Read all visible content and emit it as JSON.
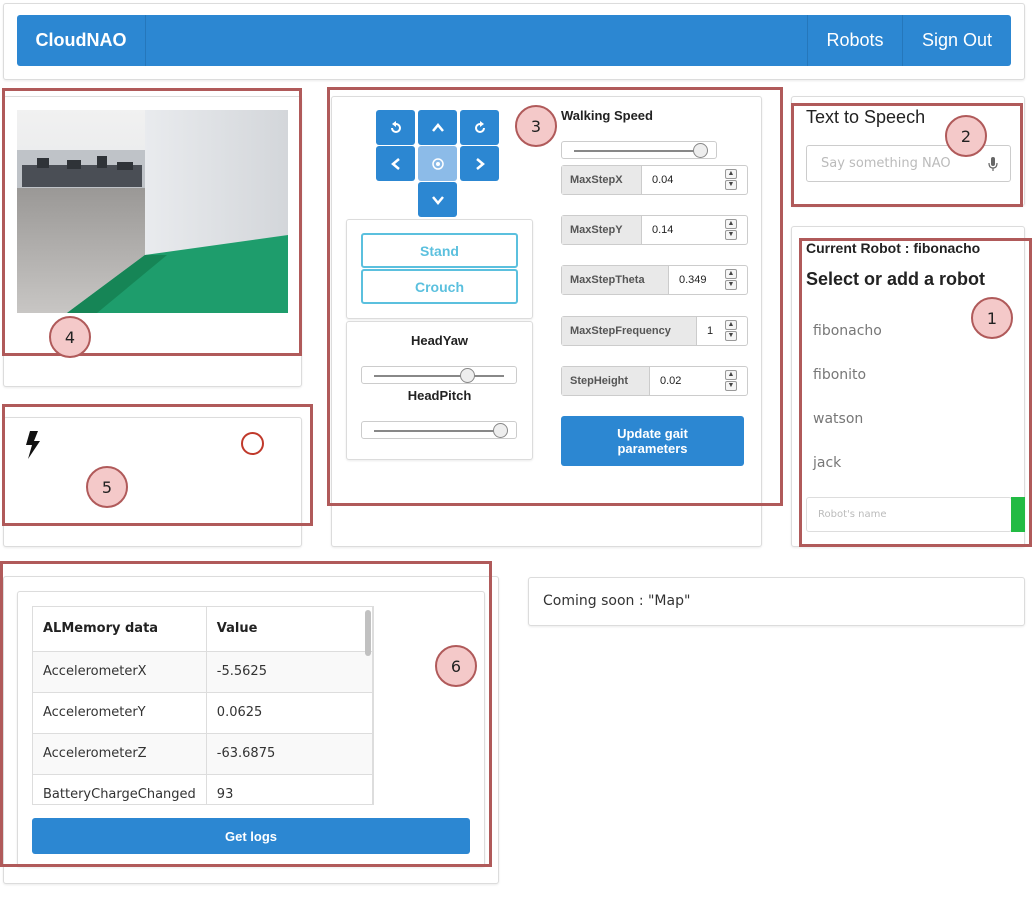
{
  "navbar": {
    "brand": "CloudNAO",
    "links": [
      "Robots",
      "Sign Out"
    ]
  },
  "markers": [
    "1",
    "2",
    "3",
    "4",
    "5",
    "6"
  ],
  "movement": {
    "buttons": [
      "rotate-left",
      "up",
      "rotate-right",
      "left",
      "center",
      "right",
      "down"
    ],
    "stand_label": "Stand",
    "crouch_label": "Crouch",
    "head_yaw_label": "HeadYaw",
    "head_pitch_label": "HeadPitch",
    "head_yaw_level": 0.73,
    "head_pitch_level": 1.0
  },
  "walking": {
    "title": "Walking Speed",
    "speed_level": 1.0,
    "params": [
      {
        "label": "MaxStepX",
        "value": "0.04"
      },
      {
        "label": "MaxStepY",
        "value": "0.14"
      },
      {
        "label": "MaxStepTheta",
        "value": "0.349"
      },
      {
        "label": "MaxStepFrequency",
        "value": "1"
      },
      {
        "label": "StepHeight",
        "value": "0.02"
      }
    ],
    "update_label_line1": "Update gait",
    "update_label_line2": "parameters"
  },
  "tts": {
    "title": "Text to Speech",
    "placeholder": "Say something NAO"
  },
  "robots": {
    "current_label": "Current Robot : fibonacho",
    "heading": "Select or add a robot",
    "items": [
      "fibonacho",
      "fibonito",
      "watson",
      "jack"
    ],
    "name_placeholder": "Robot's name"
  },
  "memory": {
    "headers": [
      "ALMemory data",
      "Value"
    ],
    "rows": [
      [
        "AccelerometerX",
        "-5.5625"
      ],
      [
        "AccelerometerY",
        "0.0625"
      ],
      [
        "AccelerometerZ",
        "-63.6875"
      ],
      [
        "BatteryChargeChanged",
        "93"
      ]
    ],
    "get_logs_label": "Get logs"
  },
  "map": {
    "text": "Coming soon : \"Map\""
  },
  "colors": {
    "primary": "#2c87d2",
    "info": "#5bc0de",
    "success": "#22bb44",
    "annotation": "#b05a5a"
  }
}
